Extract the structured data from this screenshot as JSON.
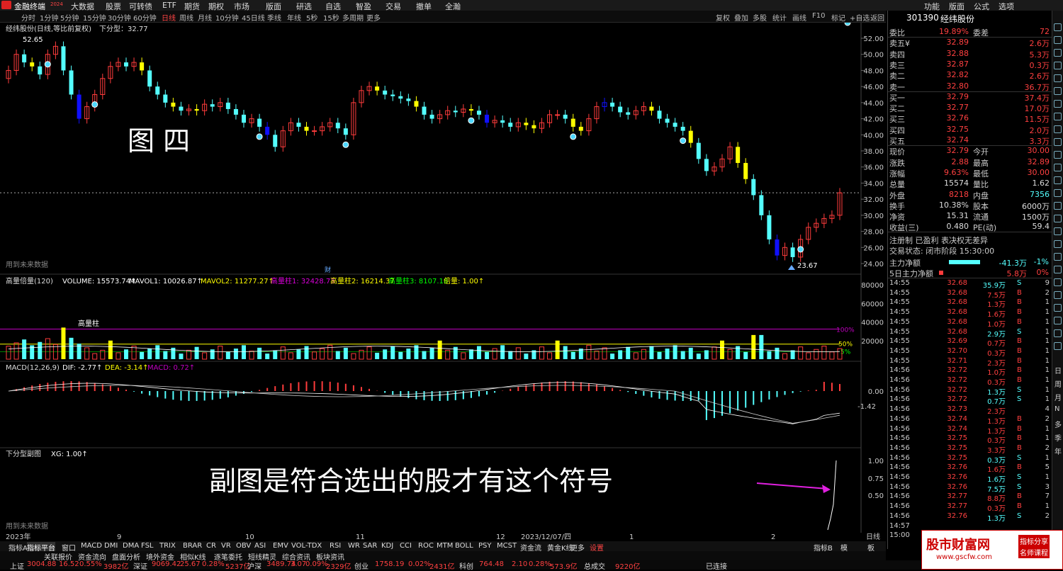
{
  "app": {
    "title": "金融终端",
    "badge": "2024"
  },
  "menu": [
    "大数据",
    "股票",
    "可转债",
    "ETF",
    "期货",
    "期权",
    "市场",
    "版面",
    "研选",
    "自选",
    "智盈",
    "交易",
    "撤单",
    "全瀚"
  ],
  "menu_right": [
    "功能",
    "版面",
    "公式",
    "选项"
  ],
  "periods": [
    "分时",
    "1分钟",
    "5分钟",
    "15分钟",
    "30分钟",
    "60分钟",
    "日线",
    "周线",
    "月线",
    "10分钟",
    "45日线",
    "季线",
    "年线",
    "5秒",
    "15秒",
    "多周期",
    "更多"
  ],
  "tools": [
    "复权",
    "叠加",
    "多股",
    "统计",
    "画线",
    "F10",
    "标记",
    "+自选",
    "返回"
  ],
  "main": {
    "title": "经纬股份(日线,等比前复权)",
    "indicator": "下分型：32.77",
    "label_image": "图 四",
    "future": "用到未来数据",
    "high": "52.65",
    "low": "23.67",
    "caiword": "财",
    "price_axis": [
      "52.00",
      "50.00",
      "48.00",
      "46.00",
      "44.00",
      "42.00",
      "40.00",
      "38.00",
      "36.00",
      "34.00",
      "32.00",
      "30.00",
      "28.00",
      "26.00",
      "24.00"
    ]
  },
  "volume": {
    "name": "高量倍量(120)",
    "vol": "VOLUME: 15573.74↑",
    "mavol1": "MAVOL1: 10026.87↑",
    "mavol2": "MAVOL2: 11277.27↑",
    "h1": "高量柱1: 32428.73",
    "h2": "高量柱2: 16214.37",
    "h3": "高量柱3: 8107.18",
    "bei": "倍量: 1.00↑",
    "gaolz": "高量柱",
    "pct": [
      "100%",
      "50%",
      "5%"
    ],
    "axis": [
      "80000",
      "60000",
      "40000",
      "20000"
    ]
  },
  "macd": {
    "name": "MACD(12,26,9)",
    "dif": "DIF: -2.77↑",
    "dea": "DEA: -3.14↑",
    "macd": "MACD: 0.72↑",
    "axis": [
      "0.00",
      "-1.42"
    ]
  },
  "sub": {
    "name": "下分型副图",
    "xg": "XG: 1.00↑",
    "annotation": "副图是符合选出的股才有这个符号",
    "future": "用到未来数据",
    "axis": [
      "1.00",
      "0.75",
      "0.50"
    ]
  },
  "dates": [
    "2023年",
    "9",
    "10",
    "11",
    "12",
    "2023/12/07/四",
    "1",
    "2"
  ],
  "period_label": "日线",
  "stock": {
    "code": "301390",
    "name": "经纬股份"
  },
  "quote": [
    [
      "委比",
      "19.89%",
      "委差",
      "72"
    ],
    [
      "卖五¥",
      "32.89",
      "",
      "2.6万"
    ],
    [
      "卖四",
      "32.88",
      "",
      "5.3万"
    ],
    [
      "卖三",
      "32.87",
      "",
      "0.3万"
    ],
    [
      "卖二",
      "32.82",
      "",
      "2.6万"
    ],
    [
      "卖一",
      "32.80",
      "",
      "36.7万"
    ],
    [
      "买一",
      "32.79",
      "",
      "37.4万"
    ],
    [
      "买二",
      "32.77",
      "",
      "17.0万"
    ],
    [
      "买三",
      "32.76",
      "",
      "11.5万"
    ],
    [
      "买四",
      "32.75",
      "",
      "2.0万"
    ],
    [
      "买五",
      "32.74",
      "",
      "3.3万"
    ],
    [
      "现价",
      "32.79",
      "今开",
      "30.00"
    ],
    [
      "涨跌",
      "2.88",
      "最高",
      "32.89"
    ],
    [
      "涨幅",
      "9.63%",
      "最低",
      "30.00"
    ],
    [
      "总量",
      "15574",
      "量比",
      "1.62"
    ],
    [
      "外盘",
      "8218",
      "内盘",
      "7356"
    ],
    [
      "换手",
      "10.38%",
      "股本",
      "6000万"
    ],
    [
      "净资",
      "15.31",
      "流通",
      "1500万"
    ],
    [
      "收益(三)",
      "0.480",
      "PE(动)",
      "59.4"
    ]
  ],
  "info1": "注册制 已盈利 表决权无差异",
  "info2": "交易状态: 闭市阶段 15:30:00",
  "flow": [
    [
      "主力净额",
      "-41.3万",
      "-1%"
    ],
    [
      "5日主力净额",
      "5.8万",
      "0%"
    ]
  ],
  "ticks": [
    [
      "14:55",
      "32.68",
      "35.9万",
      "S",
      "9"
    ],
    [
      "14:55",
      "32.68",
      "7.5万",
      "B",
      "2"
    ],
    [
      "14:55",
      "32.68",
      "1.3万",
      "B",
      "1"
    ],
    [
      "14:55",
      "32.68",
      "1.6万",
      "B",
      "1"
    ],
    [
      "14:55",
      "32.68",
      "1.0万",
      "B",
      "1"
    ],
    [
      "14:55",
      "32.68",
      "2.9万",
      "S",
      "1"
    ],
    [
      "14:55",
      "32.69",
      "0.7万",
      "B",
      "1"
    ],
    [
      "14:55",
      "32.70",
      "0.3万",
      "B",
      "1"
    ],
    [
      "14:55",
      "32.71",
      "2.3万",
      "B",
      "1"
    ],
    [
      "14:56",
      "32.72",
      "1.0万",
      "B",
      "1"
    ],
    [
      "14:56",
      "32.72",
      "0.3万",
      "B",
      "1"
    ],
    [
      "14:56",
      "32.72",
      "1.3万",
      "S",
      "1"
    ],
    [
      "14:56",
      "32.72",
      "0.7万",
      "S",
      "1"
    ],
    [
      "14:56",
      "32.73",
      "2.3万",
      "",
      "4"
    ],
    [
      "14:56",
      "32.74",
      "1.3万",
      "B",
      "2"
    ],
    [
      "14:56",
      "32.74",
      "1.3万",
      "B",
      "1"
    ],
    [
      "14:56",
      "32.75",
      "0.3万",
      "B",
      "1"
    ],
    [
      "14:56",
      "32.75",
      "3.3万",
      "B",
      "2"
    ],
    [
      "14:56",
      "32.75",
      "0.3万",
      "S",
      "1"
    ],
    [
      "14:56",
      "32.76",
      "1.6万",
      "B",
      "5"
    ],
    [
      "14:56",
      "32.76",
      "1.6万",
      "S",
      "1"
    ],
    [
      "14:56",
      "32.76",
      "7.5万",
      "S",
      "3"
    ],
    [
      "14:56",
      "32.77",
      "8.8万",
      "B",
      "7"
    ],
    [
      "14:56",
      "32.77",
      "0.3万",
      "B",
      "1"
    ],
    [
      "14:56",
      "32.76",
      "1.3万",
      "S",
      "2"
    ],
    [
      "14:57",
      "",
      "",
      "",
      ""
    ],
    [
      "15:00",
      "",
      "",
      "",
      ""
    ]
  ],
  "bottom_tabs": [
    "指标A",
    "指标平台",
    "窗口",
    "MACD",
    "DMI",
    "DMA",
    "FSL",
    "TRIX",
    "BRAR",
    "CR",
    "VR",
    "OBV",
    "ASI",
    "EMV",
    "VOL-TDX",
    "RSI",
    "WR",
    "SAR",
    "KDJ",
    "CCI",
    "ROC",
    "MTM",
    "BOLL",
    "PSY",
    "MCST",
    "资金流",
    "黄金K线",
    "更多",
    "设置"
  ],
  "bottom_right": [
    "指标B",
    "模",
    "板"
  ],
  "status": [
    "上证",
    "3004.88",
    "16.52",
    "0.55%",
    "3982亿",
    "深证",
    "9069.42",
    "25.67",
    "0.28%",
    "5237亿",
    "沪深",
    "3489.74",
    "3.07",
    "0.09%",
    "2329亿",
    "创业",
    "1758.19",
    "0.02%",
    "2431亿",
    "科创",
    "764.48",
    "2.10",
    "0.28%",
    "573.9亿",
    "总成交",
    "9220亿",
    "已连接"
  ],
  "bar_links": [
    "关联报价",
    "资金流向",
    "盘面分析",
    "境外资金",
    "相似K线",
    "逐笔委托",
    "短线精灵",
    "综合资讯",
    "板块资讯"
  ],
  "side_icons": [
    "日",
    "周",
    "月",
    "N",
    "多",
    "季",
    "年"
  ],
  "colors": {
    "up": "#ff3c3c",
    "down": "#54ffff",
    "yellow": "#ffff00",
    "blue": "#1010ff",
    "magenta": "#c000c0"
  },
  "watermark": {
    "title": "股市财富网",
    "url": "www.gscfw.com",
    "tag1": "指标分享",
    "tag2": "名师课程"
  }
}
